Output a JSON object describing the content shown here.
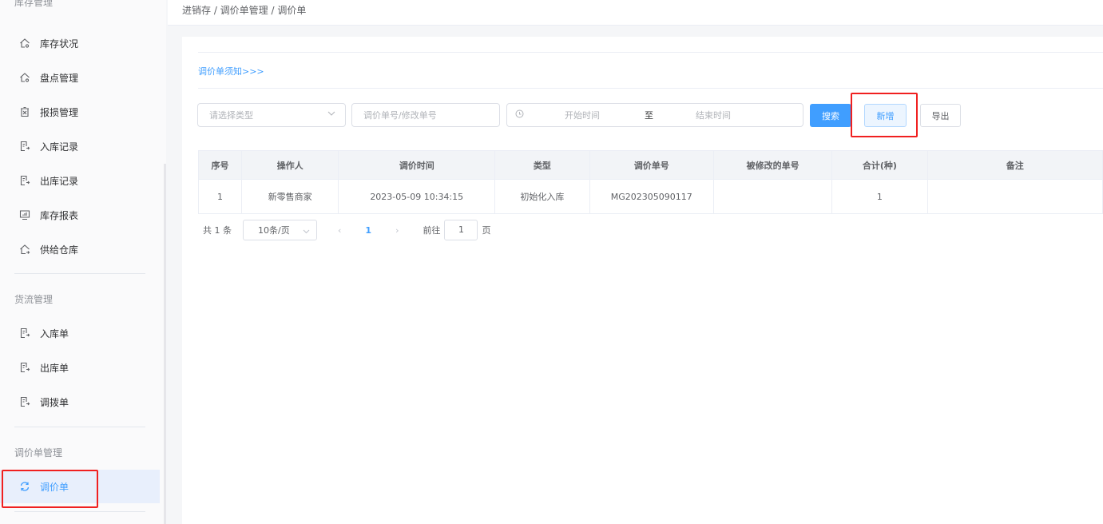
{
  "sidebar": {
    "top_group": "库存管理",
    "items": [
      {
        "label": "库存状况",
        "icon": "home-icon"
      },
      {
        "label": "盘点管理",
        "icon": "home-icon"
      },
      {
        "label": "报损管理",
        "icon": "trash-icon"
      },
      {
        "label": "入库记录",
        "icon": "doc-in-icon"
      },
      {
        "label": "出库记录",
        "icon": "doc-out-icon"
      },
      {
        "label": "库存报表",
        "icon": "monitor-icon"
      },
      {
        "label": "供给仓库",
        "icon": "warehouse-icon"
      }
    ],
    "group2": "货流管理",
    "items2": [
      {
        "label": "入库单"
      },
      {
        "label": "出库单"
      },
      {
        "label": "调拨单"
      }
    ],
    "group3": "调价单管理",
    "active": "调价单"
  },
  "breadcrumb": "进销存 / 调价单管理 / 调价单",
  "notice": "调价单须知>>>",
  "filters": {
    "type_placeholder": "请选择类型",
    "no_placeholder": "调价单号/修改单号",
    "start": "开始时间",
    "sep": "至",
    "end": "结束时间"
  },
  "buttons": {
    "search": "搜索",
    "add": "新增",
    "export": "导出"
  },
  "table": {
    "headers": [
      "序号",
      "操作人",
      "调价时间",
      "类型",
      "调价单号",
      "被修改的单号",
      "合计(种)",
      "备注"
    ],
    "rows": [
      [
        "1",
        "新零售商家",
        "2023-05-09 10:34:15",
        "初始化入库",
        "MG202305090117",
        "",
        "1",
        ""
      ]
    ]
  },
  "pager": {
    "total": "共 1 条",
    "size": "10条/页",
    "page": "1",
    "goto": "前往",
    "goto_value": "1",
    "unit": "页"
  },
  "colors": {
    "accent": "#409eff",
    "highlight": "#f02020"
  }
}
